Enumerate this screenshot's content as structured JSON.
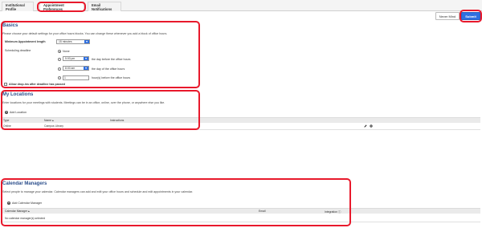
{
  "tabs": [
    {
      "label": "Institutional Profile"
    },
    {
      "label": "Appointment Preferences"
    },
    {
      "label": "Email Notifications"
    }
  ],
  "toolbar": {
    "never_mind_label": "Never Mind",
    "submit_label": "Submit"
  },
  "basics": {
    "title": "Basics",
    "description": "Please choose your default settings for your office hours blocks. You can change these whenever you add a block of office hours.",
    "min_length_label": "Minimum Appointment length",
    "min_length_value": "15 minutes",
    "deadline_label": "Scheduling deadline",
    "option_none": "None",
    "option_day_before_value": "5:00 pm",
    "option_day_before_text": "the day before the office hours",
    "option_day_of_value": "8:00 am",
    "option_day_of_text": "the day of the office hours",
    "option_hours_value": "1",
    "option_hours_text": "hour(s) before the office hours",
    "allow_dropins_label": "Allow drop-ins after deadline has passed"
  },
  "locations": {
    "title": "My Locations",
    "description": "Enter locations for your meetings with students. Meetings can be in an office, online, over the phone, or anywhere else you like.",
    "add_label": "Add Location",
    "columns": [
      "Type",
      "Name ▴",
      "Instructions"
    ],
    "rows": [
      [
        "Online",
        "Campus Library",
        ""
      ]
    ]
  },
  "calendar": {
    "title": "Calendar Managers",
    "description": "Select people to manage your calendar. Calendar managers can add and edit your office hours and schedule and edit appointments in your calendar.",
    "add_label": "Add Calendar Manager",
    "columns": [
      "Calendar Manager ▴",
      "Email",
      "Integration ⓘ"
    ],
    "empty_text": "No calendar manager(s) selected"
  },
  "colors": {
    "accent": "#2f6fe0",
    "heading": "#2c4f8c",
    "annotation": "#e8192c"
  }
}
